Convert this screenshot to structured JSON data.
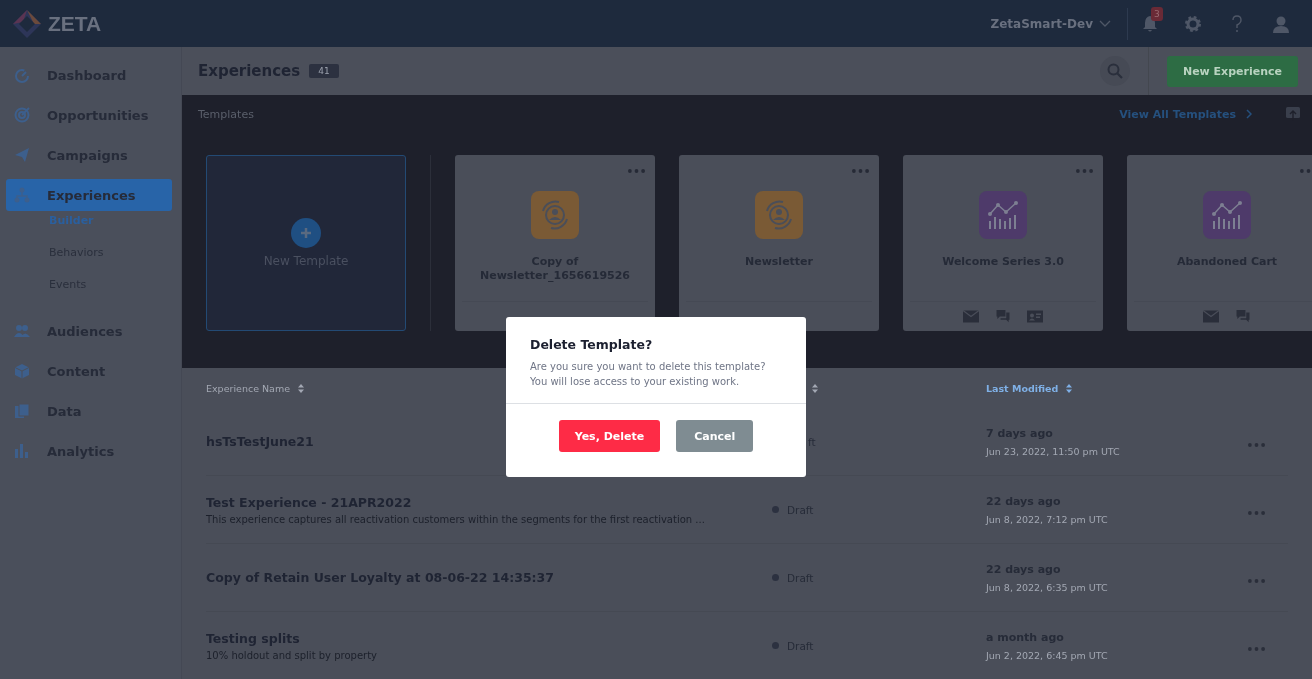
{
  "topbar": {
    "brand": "ZETA",
    "account": "ZetaSmart-Dev",
    "notifications": "3"
  },
  "sidebar": {
    "items": [
      {
        "label": "Dashboard",
        "selected": false
      },
      {
        "label": "Opportunities",
        "selected": false
      },
      {
        "label": "Campaigns",
        "selected": false
      },
      {
        "label": "Experiences",
        "selected": true,
        "children": [
          {
            "label": "Builder",
            "selected": true
          },
          {
            "label": "Behaviors",
            "selected": false
          },
          {
            "label": "Events",
            "selected": false
          }
        ]
      },
      {
        "label": "Audiences",
        "selected": false
      },
      {
        "label": "Content",
        "selected": false
      },
      {
        "label": "Data",
        "selected": false
      },
      {
        "label": "Analytics",
        "selected": false
      }
    ]
  },
  "header": {
    "title": "Experiences",
    "count": "41",
    "new_button": "New Experience"
  },
  "templates": {
    "label": "Templates",
    "view_all": "View All Templates",
    "new_template": "New Template",
    "cards": [
      {
        "name": "Copy of Newsletter_1656619526",
        "kind": "audience"
      },
      {
        "name": "Newsletter",
        "kind": "audience"
      },
      {
        "name": "Welcome Series 3.0",
        "kind": "analytics"
      },
      {
        "name": "Abandoned Cart",
        "kind": "analytics"
      }
    ]
  },
  "table": {
    "columns": [
      {
        "label": "Experience Name",
        "selected": false
      },
      {
        "selected": false
      },
      {
        "label": "Last Modified",
        "selected": true
      }
    ],
    "rows": [
      {
        "name": "hsTsTestJune21",
        "status": "ft",
        "status_dot": false,
        "modified": "7 days ago",
        "timestamp": "Jun 23, 2022, 11:50 pm UTC"
      },
      {
        "name": "Test Experience - 21APR2022",
        "description": "This experience captures all reactivation customers within the segments for the first reactivation ...",
        "status": "Draft",
        "status_dot": true,
        "modified": "22 days ago",
        "timestamp": "Jun 8, 2022, 7:12 pm UTC"
      },
      {
        "name": "Copy of Retain User Loyalty at 08-06-22 14:35:37",
        "status": "Draft",
        "status_dot": true,
        "modified": "22 days ago",
        "timestamp": "Jun 8, 2022, 6:35 pm UTC"
      },
      {
        "name": "Testing splits",
        "description": "10% holdout and split by property",
        "status": "Draft",
        "status_dot": true,
        "modified": "a month ago",
        "timestamp": "Jun 2, 2022, 6:45 pm UTC"
      }
    ]
  },
  "dialog": {
    "title": "Delete Template?",
    "message": "Are you sure you want to delete this template? You will lose access to your existing work.",
    "confirm": "Yes, Delete",
    "cancel": "Cancel"
  }
}
